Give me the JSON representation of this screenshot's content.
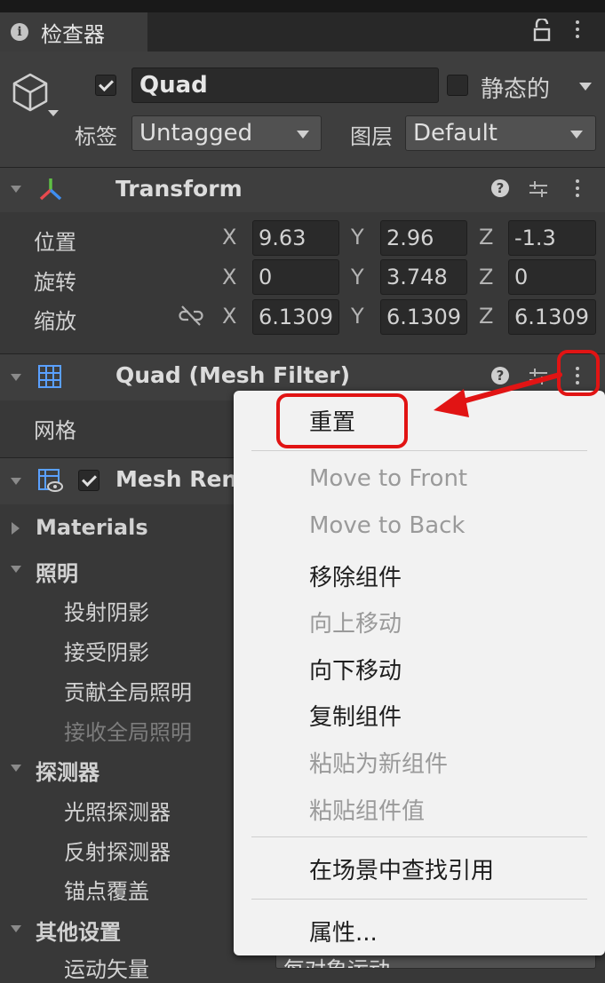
{
  "tab": {
    "title": "检查器"
  },
  "object": {
    "active": true,
    "name": "Quad",
    "static_label": "静态的",
    "static_checked": false,
    "tag_label": "标签",
    "tag_value": "Untagged",
    "layer_label": "图层",
    "layer_value": "Default"
  },
  "transform": {
    "title": "Transform",
    "rows": [
      {
        "label": "位置",
        "x": "9.63",
        "y": "2.96",
        "z": "-1.3"
      },
      {
        "label": "旋转",
        "x": "0",
        "y": "3.748",
        "z": "0"
      },
      {
        "label": "缩放",
        "x": "6.1309",
        "y": "6.1309",
        "z": "6.1309"
      }
    ],
    "axes": {
      "x": "X",
      "y": "Y",
      "z": "Z"
    }
  },
  "mesh_filter": {
    "title": "Quad (Mesh Filter)",
    "mesh_label": "网格"
  },
  "mesh_renderer": {
    "title": "Mesh Ren",
    "enabled": true,
    "sections": {
      "materials": "Materials",
      "lighting": "照明",
      "cast_shadows": "投射阴影",
      "receive_shadows": "接受阴影",
      "contribute_gi": "贡献全局照明",
      "receive_gi": "接收全局照明",
      "probes": "探测器",
      "light_probes": "光照探测器",
      "reflection_probes": "反射探测器",
      "anchor_override": "锚点覆盖",
      "other_settings": "其他设置",
      "motion_vectors": "运动矢量",
      "motion_vectors_value": "每对象运动"
    }
  },
  "context_menu": {
    "items": [
      {
        "label": "重置",
        "enabled": true
      },
      {
        "label": "Move to Front",
        "enabled": false
      },
      {
        "label": "Move to Back",
        "enabled": false
      },
      {
        "label": "移除组件",
        "enabled": true
      },
      {
        "label": "向上移动",
        "enabled": false
      },
      {
        "label": "向下移动",
        "enabled": true
      },
      {
        "label": "复制组件",
        "enabled": true
      },
      {
        "label": "粘贴为新组件",
        "enabled": false
      },
      {
        "label": "粘贴组件值",
        "enabled": false
      },
      {
        "label": "在场景中查找引用",
        "enabled": true
      },
      {
        "label": "属性...",
        "enabled": true
      }
    ]
  },
  "colors": {
    "panel_bg": "#383838",
    "header_bg": "#3e3e3e",
    "annotation_red": "#e11414",
    "menu_bg": "#f2f2f2"
  }
}
